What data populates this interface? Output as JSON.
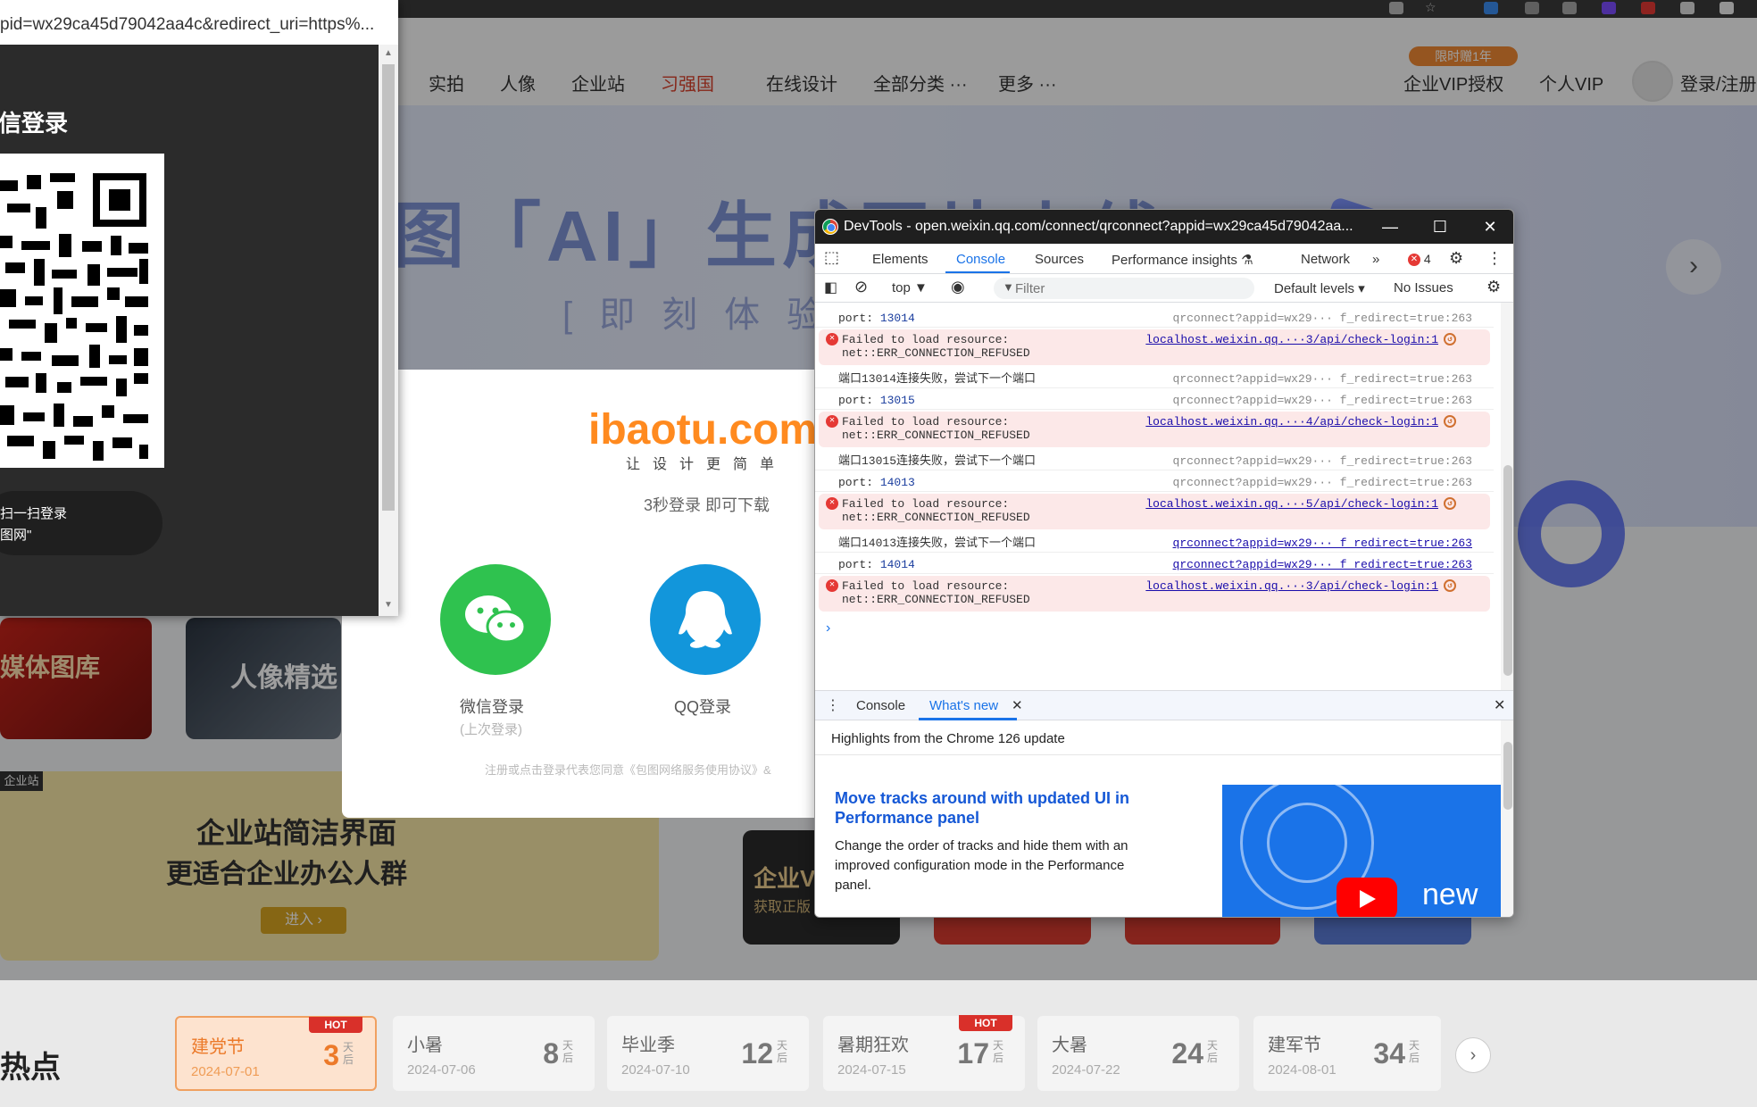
{
  "site": {
    "nav": [
      "实拍",
      "人像",
      "企业站",
      "习强国",
      "在线设计",
      "全部分类 ···",
      "更多 ···"
    ],
    "vip_badge": "限时赠1年",
    "vip_auth": "企业VIP授权",
    "personal_vip": "个人VIP",
    "login": "登录/注册",
    "hero_title": "图「AI」生成图片上线",
    "hero_sub": "[即刻体验",
    "hero_next": "›",
    "cards": {
      "media": "媒体图库",
      "portrait": "人像精选",
      "enterprise_tag": "企业站",
      "enterprise_line1": "企业站简洁界面",
      "enterprise_line2": "更适合企业办公人群",
      "enterprise_enter": "进入 ›",
      "vip_short": "企业V",
      "vip_sub": "获取正版"
    },
    "hot_title": "热点",
    "holidays": [
      {
        "name": "建党节",
        "date": "2024-07-01",
        "days": "3",
        "hot": "HOT"
      },
      {
        "name": "小暑",
        "date": "2024-07-06",
        "days": "8",
        "hot": ""
      },
      {
        "name": "毕业季",
        "date": "2024-07-10",
        "days": "12",
        "hot": ""
      },
      {
        "name": "暑期狂欢",
        "date": "2024-07-15",
        "days": "17",
        "hot": "HOT"
      },
      {
        "name": "大暑",
        "date": "2024-07-22",
        "days": "24",
        "hot": ""
      },
      {
        "name": "建军节",
        "date": "2024-08-01",
        "days": "34",
        "hot": ""
      }
    ],
    "days_unit": "天后",
    "strip_next": "›"
  },
  "modal": {
    "logo": "ibaotu.com",
    "slogan": "让设计更简单",
    "tip": "3秒登录 即可下载",
    "wechat_label": "微信登录",
    "wechat_last": "(上次登录)",
    "qq_label": "QQ登录",
    "agreement": "注册或点击登录代表您同意《包图网络服务使用协议》&"
  },
  "wechat_popup": {
    "url": "pid=wx29ca45d79042aa4c&redirect_uri=https%...",
    "title": "信登录",
    "hint_line1": "扫一扫登录",
    "hint_line2": "图网\""
  },
  "devtools": {
    "title": "DevTools - open.weixin.qq.com/connect/qrconnect?appid=wx29ca45d79042aa...",
    "tabs": [
      "Elements",
      "Console",
      "Sources",
      "Performance insights ⚗",
      "Network"
    ],
    "more_tabs": "»",
    "error_count": "4",
    "context": "top ▼",
    "filter_placeholder": "Filter",
    "default_levels": "Default levels ▾",
    "no_issues": "No Issues",
    "console_rows": [
      {
        "type": "info",
        "label": "port: ",
        "num": "13014",
        "src": "qrconnect?appid=wx29··· f_redirect=true:263",
        "linked": false
      },
      {
        "type": "err",
        "line1": "Failed to load resource:",
        "line2": "net::ERR_CONNECTION_REFUSED",
        "src": "localhost.weixin.qq.···3/api/check-login:1"
      },
      {
        "type": "info",
        "label": "端口13014连接失败，尝试下一个端口",
        "num": "",
        "src": "qrconnect?appid=wx29··· f_redirect=true:263",
        "linked": false
      },
      {
        "type": "info",
        "label": "port: ",
        "num": "13015",
        "src": "qrconnect?appid=wx29··· f_redirect=true:263",
        "linked": false
      },
      {
        "type": "err",
        "line1": "Failed to load resource:",
        "line2": "net::ERR_CONNECTION_REFUSED",
        "src": "localhost.weixin.qq.···4/api/check-login:1"
      },
      {
        "type": "info",
        "label": "端口13015连接失败，尝试下一个端口",
        "num": "",
        "src": "qrconnect?appid=wx29··· f_redirect=true:263",
        "linked": false
      },
      {
        "type": "info",
        "label": "port: ",
        "num": "14013",
        "src": "qrconnect?appid=wx29··· f_redirect=true:263",
        "linked": false
      },
      {
        "type": "err",
        "line1": "Failed to load resource:",
        "line2": "net::ERR_CONNECTION_REFUSED",
        "src": "localhost.weixin.qq.···5/api/check-login:1"
      },
      {
        "type": "info",
        "label": "端口14013连接失败，尝试下一个端口",
        "num": "",
        "src": "qrconnect?appid=wx29··· f_redirect=true:263",
        "linked": true
      },
      {
        "type": "info",
        "label": "port: ",
        "num": "14014",
        "src": "qrconnect?appid=wx29··· f_redirect=true:263",
        "linked": true
      },
      {
        "type": "err",
        "line1": "Failed to load resource:",
        "line2": "net::ERR_CONNECTION_REFUSED",
        "src": "localhost.weixin.qq.···3/api/check-login:1"
      }
    ],
    "prompt": "›",
    "drawer_tabs": {
      "console": "Console",
      "whats_new": "What's new"
    },
    "highlights": "Highlights from the Chrome 126 update",
    "wn_title": "Move tracks around with updated UI in Performance panel",
    "wn_desc": "Change the order of tracks and hide them with an improved configuration mode in the Performance panel.",
    "wn_img_text": "new"
  }
}
